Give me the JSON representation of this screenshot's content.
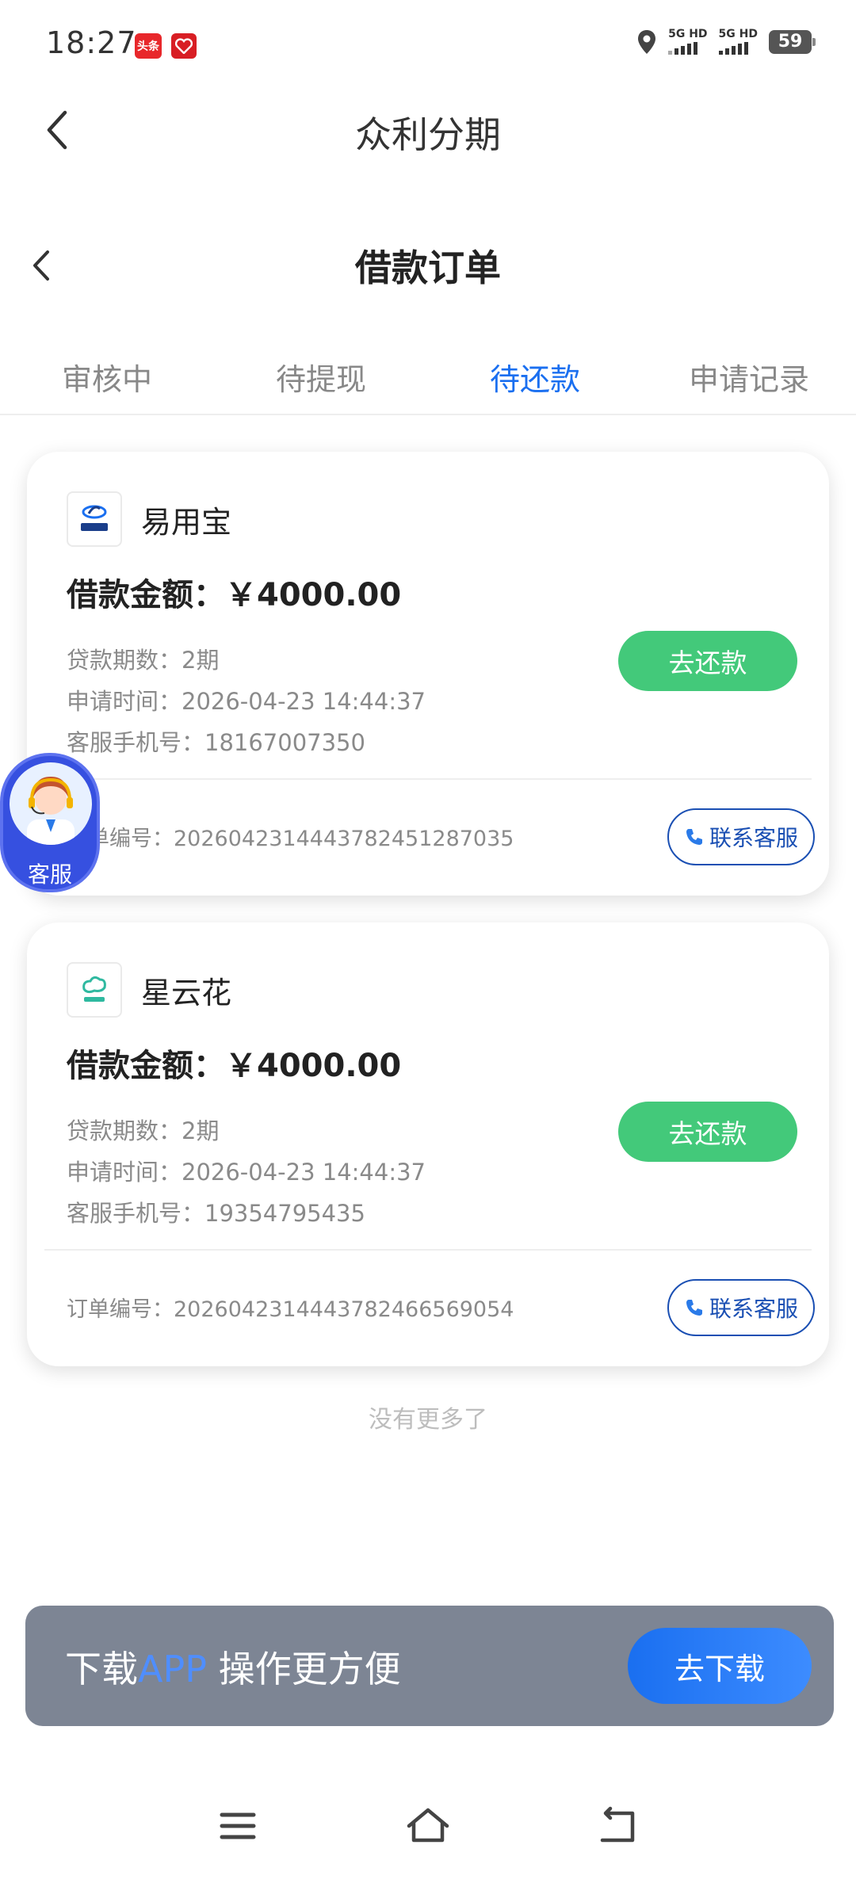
{
  "status_bar": {
    "time": "18:27",
    "app_badge_1": "头条",
    "signal_1": "5G HD",
    "signal_2": "5G HD",
    "battery": "59"
  },
  "outer_header": {
    "title": "众利分期"
  },
  "page_header": {
    "title": "借款订单"
  },
  "tabs": [
    {
      "label": "审核中"
    },
    {
      "label": "待提现"
    },
    {
      "label": "待还款"
    },
    {
      "label": "申请记录"
    }
  ],
  "active_tab": "待还款",
  "orders": [
    {
      "product": "易用宝",
      "logo_text": "易用宝",
      "amount": "借款金额：￥4000.00",
      "term": "贷款期数：2期",
      "apply_time": "申请时间：2026-04-23 14:44:37",
      "phone": "客服手机号：18167007350",
      "repay_label": "去还款",
      "order_no": "订单编号：20260423144437824512870​35",
      "contact_label": "联系客服"
    },
    {
      "product": "星云花",
      "logo_text": "星云花",
      "amount": "借款金额：￥4000.00",
      "term": "贷款期数：2期",
      "apply_time": "申请时间：2026-04-23 14:44:37",
      "phone": "客服手机号：19354795435",
      "repay_label": "去还款",
      "order_no": "订单编号：2026042314443782466569054",
      "contact_label": "联系客服"
    }
  ],
  "no_more": "没有更多了",
  "service_float": {
    "label": "客服"
  },
  "download_banner": {
    "text_pre": "下载",
    "text_highlight": "APP",
    "text_post": " 操作更方便",
    "button": "去下载"
  },
  "colors": {
    "accent": "#1a6ff0",
    "repay_green": "#43c97a",
    "contact_blue": "#1a4fb3",
    "banner_bg": "#7d8594"
  }
}
